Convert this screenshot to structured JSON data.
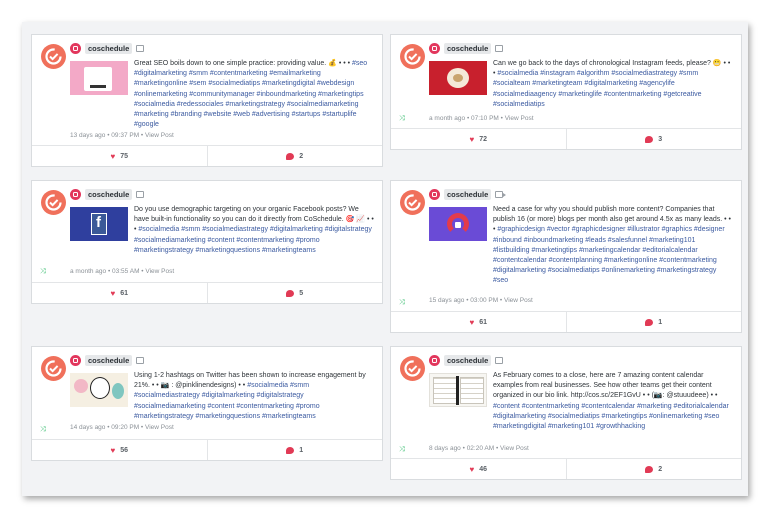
{
  "posts": [
    {
      "account": "coschedule",
      "media": "image-icon",
      "caption": "Great SEO boils down to one simple practice: providing value. 💰 • • •",
      "tags": "#seo #digitalmarketing #smm #contentmarketing #emailmarketing #marketingonline #sem #socialmediatips #marketingdigital #webdesign #onlinemarketing #communitymanager #inboundmarketing #marketingtips #socialmedia #redessociales #marketingstrategy #socialmediamarketing #marketing #branding #website #web #advertising #startups #startuplife #google",
      "meta": "13 days ago • 09:37 PM • View Post",
      "likes": "75",
      "comments": "2"
    },
    {
      "account": "coschedule",
      "media": "image-icon",
      "caption": "Can we go back to the days of chronological Instagram feeds, please? 😬 • • •",
      "tags": "#socialmedia #instagram #algorithm #socialmediastrategy #smm #socialteam #marketingteam #digitalmarketing #agencylife #socialmediaagency #marketinglife #contentmarketing #getcreative #socialmediatips",
      "meta": "a month ago • 07:10 PM • View Post",
      "likes": "72",
      "comments": "3"
    },
    {
      "account": "coschedule",
      "media": "image-icon",
      "caption": "Do you use demographic targeting on your organic Facebook posts? We have built-in functionality so you can do it directly from CoSchedule. 🎯 📈 • • •",
      "tags": "#socialmedia #smm #socialmediastrategy #digitalmarketing #digitalstrategy #socialmediamarketing #content #contentmarketing #promo #marketingstrategy #marketingquestions #marketingteams",
      "meta": "a month ago • 03:55 AM • View Post",
      "likes": "61",
      "comments": "5"
    },
    {
      "account": "coschedule",
      "media": "video-icon",
      "caption": "Need a case for why you should publish more content? Companies that publish 16 (or more) blogs per month also get around 4.5x as many leads. • • •",
      "tags": "#graphicdesign #vector #graphicdesigner #illustrator #graphics #designer #inbound #inboundmarketing #leads #salesfunnel #marketing101 #listbuilding #marketingtips #marketingcalendar #editorialcalendar #contentcalendar #contentplanning #marketingonline #contentmarketing #digitalmarketing #socialmediatips #onlinemarketing #marketingstrategy #seo",
      "meta": "15 days ago • 03:00 PM • View Post",
      "likes": "61",
      "comments": "1"
    },
    {
      "account": "coschedule",
      "media": "image-icon",
      "caption": "Using 1-2 hashtags on Twitter has been shown to increase engagement by 21%. • • 📷 : @pinklinendesigns) • •",
      "tags": "#socialmedia #smm #socialmediastrategy #digitalmarketing #digitalstrategy #socialmediamarketing #content #contentmarketing #promo #marketingstrategy #marketingquestions #marketingteams",
      "meta": "14 days ago • 09:20 PM • View Post",
      "likes": "56",
      "comments": "1"
    },
    {
      "account": "coschedule",
      "media": "image-icon",
      "caption": "As February comes to a close, here are 7 amazing content calendar examples from real businesses. See how other teams get their content organized in our bio link. http://cos.sc/2EF1GvU • • (📷: @stuuudeee) • •",
      "tags": "#content #contentmarketing #contentcalendar #marketing #editorialcalendar #digitalmarketing #socialmediatips #marketingtips #onlinemarketing #seo #marketingdigital #marketing101 #growthhacking",
      "meta": "8 days ago • 02:20 AM • View Post",
      "likes": "46",
      "comments": "2"
    }
  ],
  "colors": {
    "brand": "#f0705b",
    "heart": "#e13a55",
    "tag": "#3b5aa0",
    "shuffle": "#3fbf74"
  }
}
